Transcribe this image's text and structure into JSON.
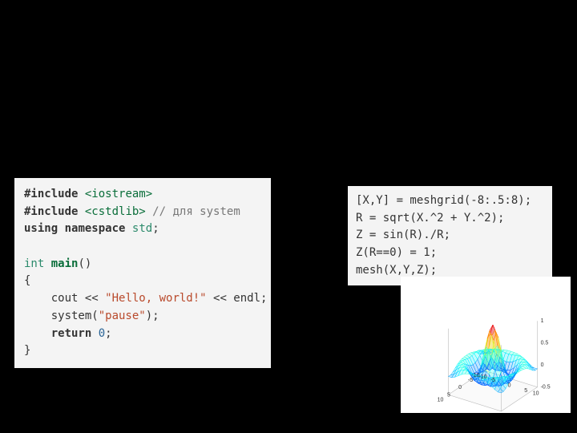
{
  "cpp": {
    "l1a": "#include",
    "l1b": "<iostream>",
    "l2a": "#include",
    "l2b": "<cstdlib>",
    "l2c": "// для system",
    "l3a": "using",
    "l3b": "namespace",
    "l3c": "std",
    "l3d": ";",
    "l5a": "int",
    "l5b": "main",
    "l5c": "()",
    "l6": "{",
    "l7a": "    cout << ",
    "l7b": "\"Hello, world!\"",
    "l7c": " << endl;",
    "l8a": "    system(",
    "l8b": "\"pause\"",
    "l8c": ");",
    "l9a": "    ",
    "l9b": "return",
    "l9c": " ",
    "l9d": "0",
    "l9e": ";",
    "l10": "}"
  },
  "matlab": {
    "l1": "[X,Y] = meshgrid(-8:.5:8);",
    "l2": "R = sqrt(X.^2 + Y.^2);",
    "l3": "Z = sin(R)./R;",
    "l4": "Z(R==0) = 1;",
    "l5": "mesh(X,Y,Z);"
  },
  "chart_data": {
    "type": "surface-mesh",
    "title": "",
    "function": "Z = sin(R)/R, R = sqrt(X^2+Y^2)",
    "x_range": [
      -8,
      8
    ],
    "y_range": [
      -8,
      8
    ],
    "z_range": [
      -0.5,
      1
    ],
    "x_ticks": [
      -10,
      -5,
      0,
      5,
      10
    ],
    "y_ticks": [
      -10,
      -5,
      0,
      5,
      10
    ],
    "z_ticks": [
      -0.5,
      0,
      0.5,
      1
    ],
    "step": 0.5
  },
  "axis_labels": {
    "z1": "1",
    "z05": "0.5",
    "z0": "0",
    "zn05": "-0.5",
    "xn10": "-10",
    "xn5": "-5",
    "x0": "0",
    "x5": "5",
    "x10": "10",
    "yn10": "-10",
    "yn5": "-5",
    "y0": "0",
    "y5": "5",
    "y10": "10"
  }
}
